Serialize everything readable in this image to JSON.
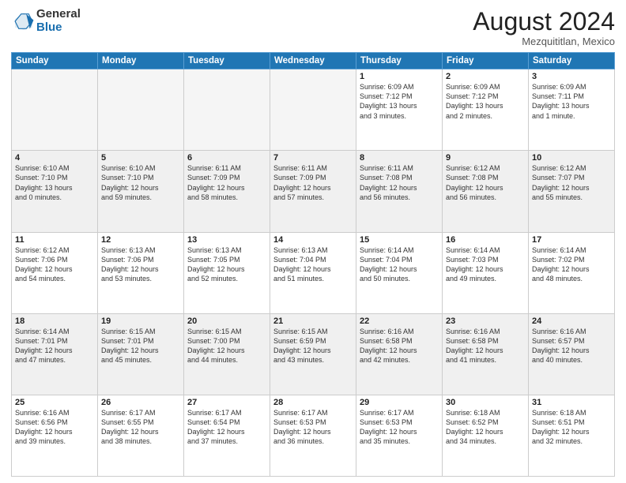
{
  "logo": {
    "general": "General",
    "blue": "Blue"
  },
  "title": "August 2024",
  "location": "Mezquititlan, Mexico",
  "days_of_week": [
    "Sunday",
    "Monday",
    "Tuesday",
    "Wednesday",
    "Thursday",
    "Friday",
    "Saturday"
  ],
  "weeks": [
    [
      {
        "num": "",
        "info": "",
        "empty": true
      },
      {
        "num": "",
        "info": "",
        "empty": true
      },
      {
        "num": "",
        "info": "",
        "empty": true
      },
      {
        "num": "",
        "info": "",
        "empty": true
      },
      {
        "num": "1",
        "info": "Sunrise: 6:09 AM\nSunset: 7:12 PM\nDaylight: 13 hours\nand 3 minutes."
      },
      {
        "num": "2",
        "info": "Sunrise: 6:09 AM\nSunset: 7:12 PM\nDaylight: 13 hours\nand 2 minutes."
      },
      {
        "num": "3",
        "info": "Sunrise: 6:09 AM\nSunset: 7:11 PM\nDaylight: 13 hours\nand 1 minute."
      }
    ],
    [
      {
        "num": "4",
        "info": "Sunrise: 6:10 AM\nSunset: 7:10 PM\nDaylight: 13 hours\nand 0 minutes."
      },
      {
        "num": "5",
        "info": "Sunrise: 6:10 AM\nSunset: 7:10 PM\nDaylight: 12 hours\nand 59 minutes."
      },
      {
        "num": "6",
        "info": "Sunrise: 6:11 AM\nSunset: 7:09 PM\nDaylight: 12 hours\nand 58 minutes."
      },
      {
        "num": "7",
        "info": "Sunrise: 6:11 AM\nSunset: 7:09 PM\nDaylight: 12 hours\nand 57 minutes."
      },
      {
        "num": "8",
        "info": "Sunrise: 6:11 AM\nSunset: 7:08 PM\nDaylight: 12 hours\nand 56 minutes."
      },
      {
        "num": "9",
        "info": "Sunrise: 6:12 AM\nSunset: 7:08 PM\nDaylight: 12 hours\nand 56 minutes."
      },
      {
        "num": "10",
        "info": "Sunrise: 6:12 AM\nSunset: 7:07 PM\nDaylight: 12 hours\nand 55 minutes."
      }
    ],
    [
      {
        "num": "11",
        "info": "Sunrise: 6:12 AM\nSunset: 7:06 PM\nDaylight: 12 hours\nand 54 minutes."
      },
      {
        "num": "12",
        "info": "Sunrise: 6:13 AM\nSunset: 7:06 PM\nDaylight: 12 hours\nand 53 minutes."
      },
      {
        "num": "13",
        "info": "Sunrise: 6:13 AM\nSunset: 7:05 PM\nDaylight: 12 hours\nand 52 minutes."
      },
      {
        "num": "14",
        "info": "Sunrise: 6:13 AM\nSunset: 7:04 PM\nDaylight: 12 hours\nand 51 minutes."
      },
      {
        "num": "15",
        "info": "Sunrise: 6:14 AM\nSunset: 7:04 PM\nDaylight: 12 hours\nand 50 minutes."
      },
      {
        "num": "16",
        "info": "Sunrise: 6:14 AM\nSunset: 7:03 PM\nDaylight: 12 hours\nand 49 minutes."
      },
      {
        "num": "17",
        "info": "Sunrise: 6:14 AM\nSunset: 7:02 PM\nDaylight: 12 hours\nand 48 minutes."
      }
    ],
    [
      {
        "num": "18",
        "info": "Sunrise: 6:14 AM\nSunset: 7:01 PM\nDaylight: 12 hours\nand 47 minutes."
      },
      {
        "num": "19",
        "info": "Sunrise: 6:15 AM\nSunset: 7:01 PM\nDaylight: 12 hours\nand 45 minutes."
      },
      {
        "num": "20",
        "info": "Sunrise: 6:15 AM\nSunset: 7:00 PM\nDaylight: 12 hours\nand 44 minutes."
      },
      {
        "num": "21",
        "info": "Sunrise: 6:15 AM\nSunset: 6:59 PM\nDaylight: 12 hours\nand 43 minutes."
      },
      {
        "num": "22",
        "info": "Sunrise: 6:16 AM\nSunset: 6:58 PM\nDaylight: 12 hours\nand 42 minutes."
      },
      {
        "num": "23",
        "info": "Sunrise: 6:16 AM\nSunset: 6:58 PM\nDaylight: 12 hours\nand 41 minutes."
      },
      {
        "num": "24",
        "info": "Sunrise: 6:16 AM\nSunset: 6:57 PM\nDaylight: 12 hours\nand 40 minutes."
      }
    ],
    [
      {
        "num": "25",
        "info": "Sunrise: 6:16 AM\nSunset: 6:56 PM\nDaylight: 12 hours\nand 39 minutes."
      },
      {
        "num": "26",
        "info": "Sunrise: 6:17 AM\nSunset: 6:55 PM\nDaylight: 12 hours\nand 38 minutes."
      },
      {
        "num": "27",
        "info": "Sunrise: 6:17 AM\nSunset: 6:54 PM\nDaylight: 12 hours\nand 37 minutes."
      },
      {
        "num": "28",
        "info": "Sunrise: 6:17 AM\nSunset: 6:53 PM\nDaylight: 12 hours\nand 36 minutes."
      },
      {
        "num": "29",
        "info": "Sunrise: 6:17 AM\nSunset: 6:53 PM\nDaylight: 12 hours\nand 35 minutes."
      },
      {
        "num": "30",
        "info": "Sunrise: 6:18 AM\nSunset: 6:52 PM\nDaylight: 12 hours\nand 34 minutes."
      },
      {
        "num": "31",
        "info": "Sunrise: 6:18 AM\nSunset: 6:51 PM\nDaylight: 12 hours\nand 32 minutes."
      }
    ]
  ]
}
